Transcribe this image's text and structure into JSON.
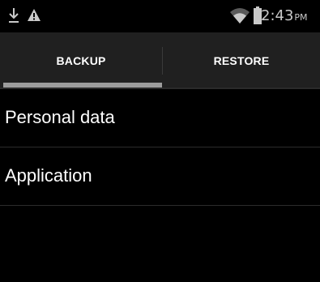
{
  "status_bar": {
    "left_icons": [
      "download-icon",
      "warning-icon"
    ],
    "right_icons": [
      "wifi-icon",
      "battery-icon"
    ],
    "time": "2:43",
    "ampm": "PM"
  },
  "tabs": [
    {
      "label": "BACKUP",
      "selected": true
    },
    {
      "label": "RESTORE",
      "selected": false
    }
  ],
  "list": {
    "items": [
      {
        "label": "Personal data"
      },
      {
        "label": "Application"
      }
    ]
  },
  "colors": {
    "background": "#000000",
    "tab_bar": "#202020",
    "tab_indicator": "#9c9c9c",
    "text": "#ffffff",
    "status_text": "#c9c9c9"
  }
}
